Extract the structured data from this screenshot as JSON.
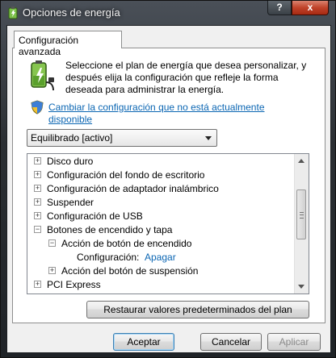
{
  "window": {
    "title": "Opciones de energía",
    "help_label": "?",
    "close_label": "x"
  },
  "tab": {
    "label": "Configuración avanzada"
  },
  "intro": {
    "text": "Seleccione el plan de energía que desea personalizar, y después elija la configuración que refleje la forma deseada para administrar la energía.",
    "change_link": "Cambiar la configuración que no está actualmente disponible"
  },
  "plan": {
    "selected": "Equilibrado [activo]"
  },
  "tree": {
    "items": [
      {
        "label": "Disco duro",
        "expander": "+"
      },
      {
        "label": "Configuración del fondo de escritorio",
        "expander": "+"
      },
      {
        "label": "Configuración de adaptador inalámbrico",
        "expander": "+"
      },
      {
        "label": "Suspender",
        "expander": "+"
      },
      {
        "label": "Configuración de USB",
        "expander": "+"
      },
      {
        "label": "Botones de encendido y tapa",
        "expander": "−"
      },
      {
        "label": "Acción de botón de encendido",
        "expander": "−"
      },
      {
        "label": "Configuración:",
        "value": "Apagar"
      },
      {
        "label": "Acción del botón de suspensión",
        "expander": "+"
      },
      {
        "label": "PCI Express",
        "expander": "+"
      }
    ]
  },
  "buttons": {
    "restore": "Restaurar valores predeterminados del plan",
    "ok": "Aceptar",
    "cancel": "Cancelar",
    "apply": "Aplicar"
  },
  "colors": {
    "link": "#0b66b3",
    "close_button": "#c0432a"
  },
  "icons": {
    "app": "power-options-icon",
    "battery": "battery-plug-icon",
    "shield": "uac-shield-icon"
  }
}
